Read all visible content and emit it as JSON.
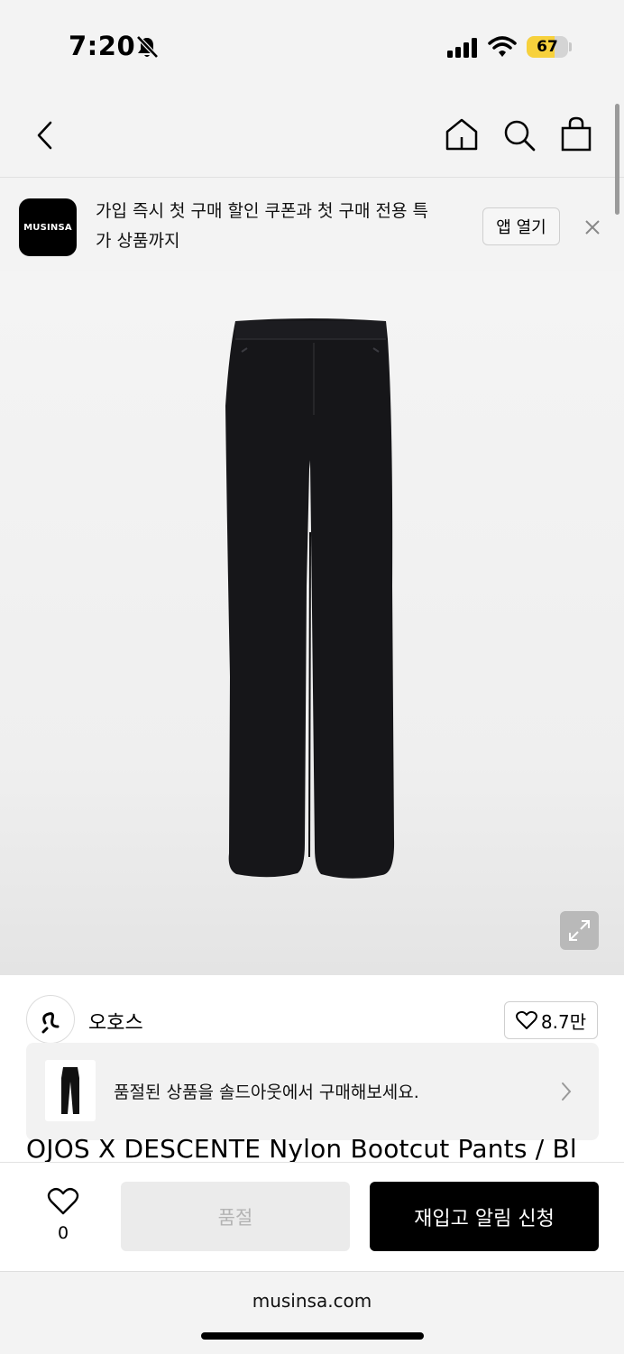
{
  "status_bar": {
    "time": "7:20",
    "battery_percent": "67",
    "battery_level": 0.67,
    "battery_color": "#f7d13c"
  },
  "nav": {
    "icons": [
      "back-icon",
      "home-icon",
      "search-icon",
      "bag-icon"
    ]
  },
  "banner": {
    "logo_text": "MUSINSA",
    "line1": "가입 즉시 첫 구매 할인 쿠폰과 첫 구매 전용 특",
    "line2": "가 상품까지",
    "open_app_label": "앱 열기",
    "close_icon": "close-icon"
  },
  "product": {
    "brand_name": "오호스",
    "like_count": "8.7만",
    "soldout_notice": "품절된 상품을 솔드아웃에서 구매해보세요.",
    "title": "OJOS X DESCENTE Nylon Bootcut Pants / Bl"
  },
  "action_bar": {
    "wish_count": "0",
    "soldout_label": "품절",
    "restock_label": "재입고 알림 신청"
  },
  "browser": {
    "url": "musinsa.com"
  },
  "colors": {
    "background": "#f3f3f3",
    "primary_button": "#000000",
    "disabled_button": "#ebebeb"
  }
}
